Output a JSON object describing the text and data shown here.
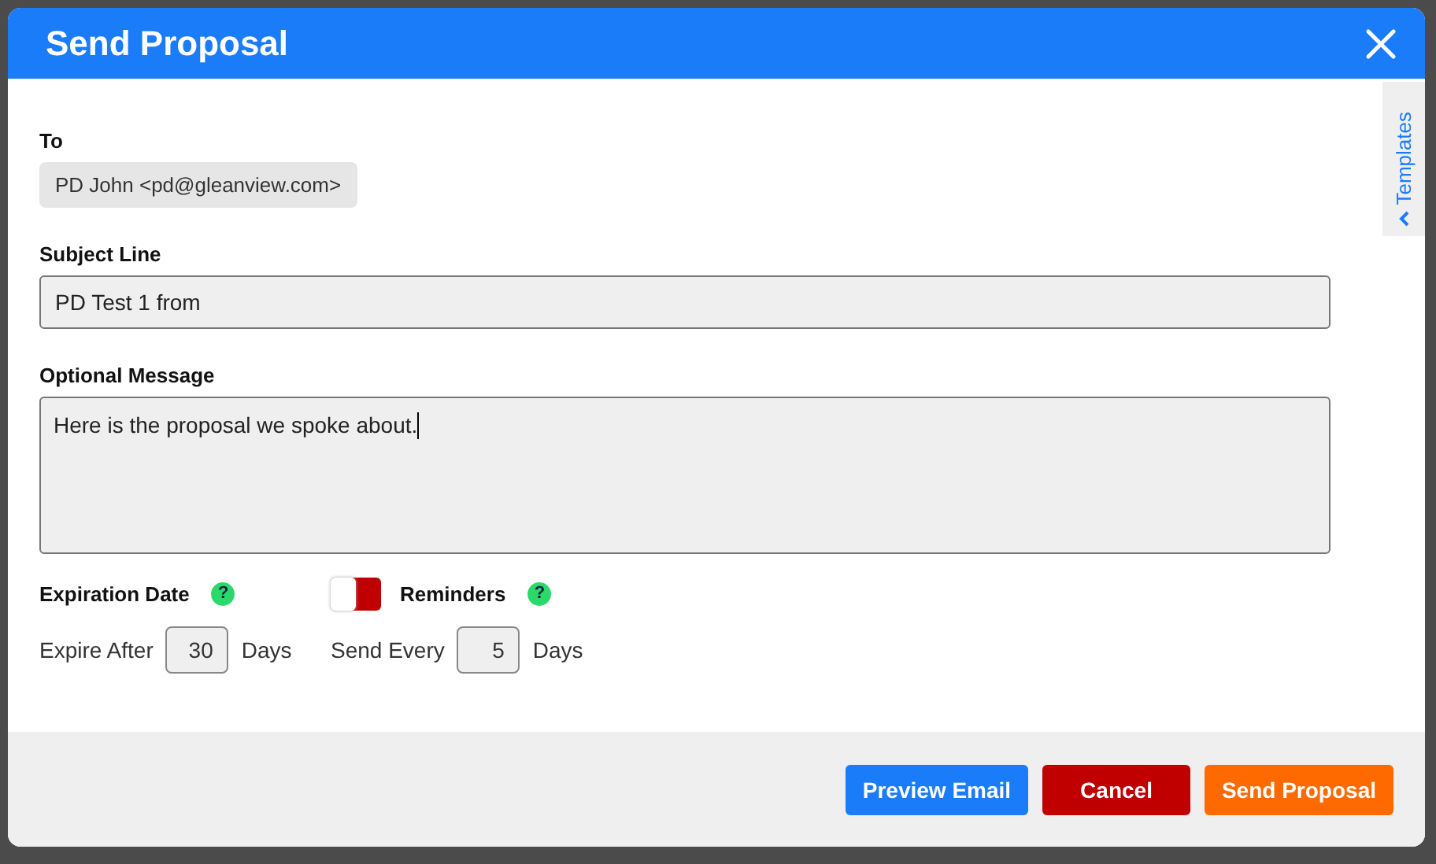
{
  "dialog": {
    "title": "Send Proposal"
  },
  "to": {
    "label": "To",
    "recipient": "PD John <pd@gleanview.com>"
  },
  "subject": {
    "label": "Subject Line",
    "value": "PD Test 1 from"
  },
  "message": {
    "label": "Optional Message",
    "value": "Here is the proposal we spoke about."
  },
  "templates_tab": {
    "label": "Templates"
  },
  "expiration": {
    "label": "Expiration Date",
    "help": "?",
    "prefix": "Expire After",
    "value": "30",
    "suffix": "Days"
  },
  "reminders": {
    "label": "Reminders",
    "help": "?",
    "on": false,
    "prefix": "Send Every",
    "value": "5",
    "suffix": "Days"
  },
  "buttons": [
    {
      "label": "Preview Email",
      "kind": "preview"
    },
    {
      "label": "Cancel",
      "kind": "cancel"
    },
    {
      "label": "Send Proposal",
      "kind": "send"
    }
  ]
}
